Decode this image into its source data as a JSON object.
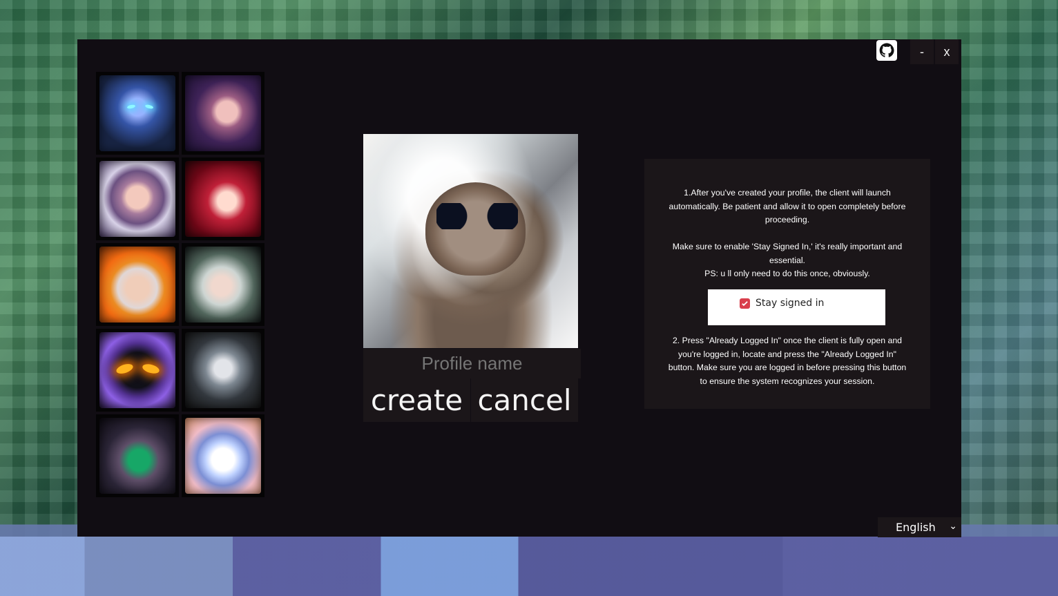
{
  "window": {
    "controls": {
      "minimize": "-",
      "close": "x"
    }
  },
  "avatars": [
    {
      "name": "blue-ghost-portrait"
    },
    {
      "name": "purple-hair-portrait"
    },
    {
      "name": "armored-white-portrait"
    },
    {
      "name": "red-hair-portrait"
    },
    {
      "name": "golden-crown-portrait"
    },
    {
      "name": "white-hair-portrait"
    },
    {
      "name": "dark-mage-portrait"
    },
    {
      "name": "beast-warrior-portrait"
    },
    {
      "name": "masked-green-portrait"
    },
    {
      "name": "cat-portrait"
    }
  ],
  "profile": {
    "placeholder": "Profile name",
    "create_label": "create",
    "cancel_label": "cancel"
  },
  "instructions": {
    "step1": "1.After you've created your profile, the client will launch automatically. Be patient and allow it to open completely before proceeding.\n\nMake sure to enable 'Stay Signed In,' it's really important and essential.\nPS: u ll only need to do this once, obviously.",
    "stay_signed_in": "Stay signed in",
    "step2": "2. Press \"Already Logged In\" once the client is fully open and you're logged in, locate and press the \"Already Logged In\" button. Make sure you are logged in before pressing this button to ensure the system recognizes your session."
  },
  "language": {
    "selected": "English"
  },
  "colors": {
    "window_bg": "#110d13",
    "panel_bg": "#1b1619",
    "checkbox": "#d93e4c"
  },
  "icons": {
    "github": "github-icon",
    "check": "check-icon",
    "chevron": "chevron-down-icon"
  }
}
